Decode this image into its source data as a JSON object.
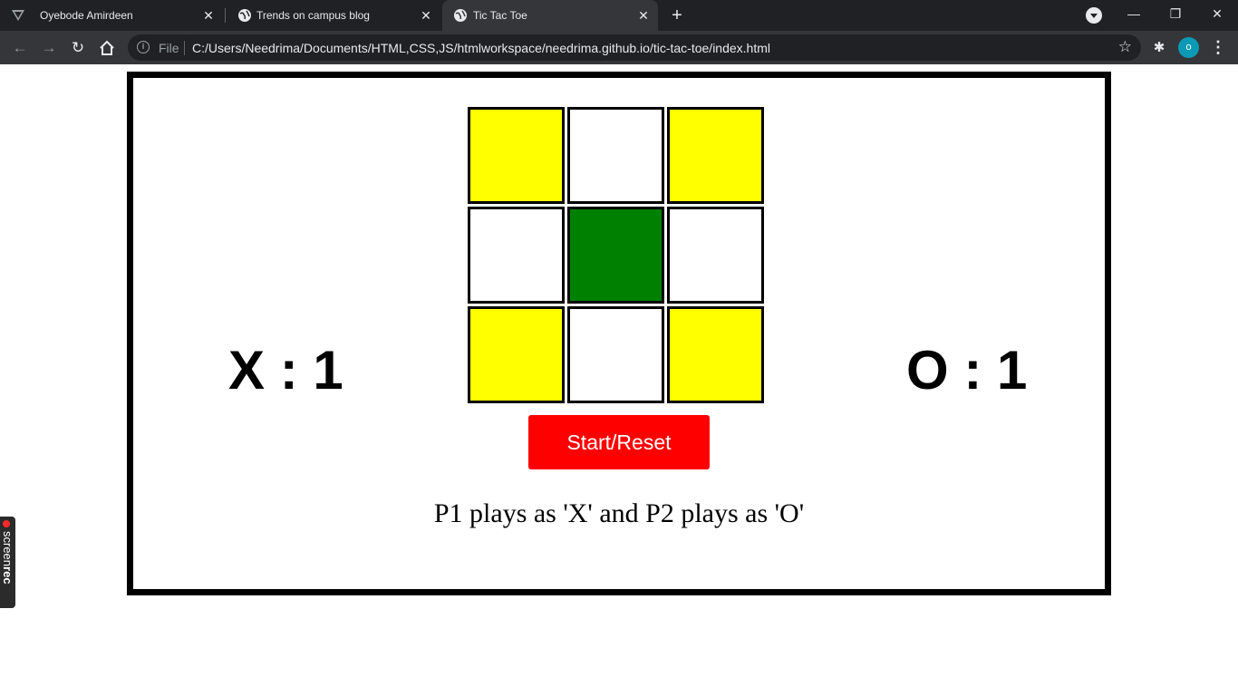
{
  "browser": {
    "tabs": [
      {
        "title": "Oyebode Amirdeen",
        "active": false
      },
      {
        "title": "Trends on campus blog",
        "active": false
      },
      {
        "title": "Tic Tac Toe",
        "active": true
      }
    ],
    "new_tab_symbol": "+",
    "omnibox": {
      "scheme_label": "File",
      "url": "C:/Users/Needrima/Documents/HTML,CSS,JS/htmlworkspace/needrima.github.io/tic-tac-toe/index.html"
    },
    "profile_initial": "o"
  },
  "game": {
    "score_x": "X : 1",
    "score_o": "O : 1",
    "board": [
      {
        "color": "#ffff00"
      },
      {
        "color": "#ffffff"
      },
      {
        "color": "#ffff00"
      },
      {
        "color": "#ffffff"
      },
      {
        "color": "#008000"
      },
      {
        "color": "#ffffff"
      },
      {
        "color": "#ffff00"
      },
      {
        "color": "#ffffff"
      },
      {
        "color": "#ffff00"
      }
    ],
    "start_reset_label": "Start/Reset",
    "info_text": "P1 plays as 'X' and P2 plays as 'O'"
  },
  "overlay": {
    "screenrec_light": "screen",
    "screenrec_bold": "rec"
  },
  "colors": {
    "frame_border": "#000000",
    "button_bg": "#ff0000",
    "cell_yellow": "#ffff00",
    "cell_green": "#008000"
  }
}
